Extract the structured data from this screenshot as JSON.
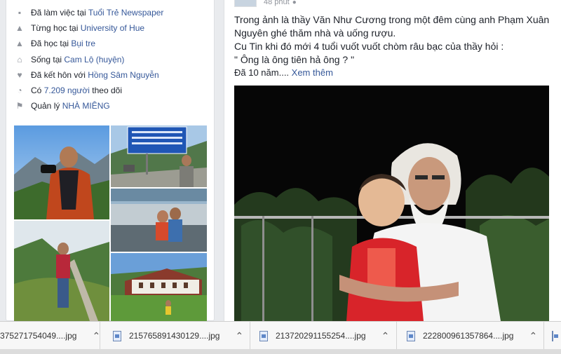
{
  "intro": [
    {
      "icon": "briefcase-icon",
      "glyph": "▪",
      "prefix": "Đã làm việc tại ",
      "link": "Tuổi Trẻ Newspaper",
      "suffix": ""
    },
    {
      "icon": "graduation-cap-icon",
      "glyph": "▲",
      "prefix": "Từng học tại ",
      "link": "University of Hue",
      "suffix": ""
    },
    {
      "icon": "graduation-cap-icon",
      "glyph": "▲",
      "prefix": "Đã học tại ",
      "link": "Bụi tre",
      "suffix": ""
    },
    {
      "icon": "home-icon",
      "glyph": "⌂",
      "prefix": "Sống tại ",
      "link": "Cam Lộ (huyện)",
      "suffix": ""
    },
    {
      "icon": "heart-icon",
      "glyph": "♥",
      "prefix": "Đã kết hôn với ",
      "link": "Hồng Sâm Nguyễn",
      "suffix": ""
    },
    {
      "icon": "rss-icon",
      "glyph": "◔",
      "prefix": "Có ",
      "link": "7.209 người",
      "suffix": " theo dõi"
    },
    {
      "icon": "flag-icon",
      "glyph": "⚑",
      "prefix": "Quản lý ",
      "link": "NHÀ MIÊNG",
      "suffix": ""
    }
  ],
  "post": {
    "time": "48 phút",
    "lines": [
      "Trong ảnh là thầy Văn Như Cương trong một đêm cùng anh Phạm Xuân",
      "Nguyên ghé thăm nhà và uống rượu.",
      "Cu Tin khi đó mới 4 tuổi vuốt vuốt chòm râu bạc của thầy hỏi :",
      "\" Ông là ông tiên hả ông ? \""
    ],
    "more_prefix": "Đã 10 năm.... ",
    "more_link": "Xem thêm"
  },
  "downloads": [
    {
      "name": "375271754049....jpg"
    },
    {
      "name": "215765891430129....jpg"
    },
    {
      "name": "213720291155254....jpg"
    },
    {
      "name": "222800961357864....jpg"
    }
  ]
}
